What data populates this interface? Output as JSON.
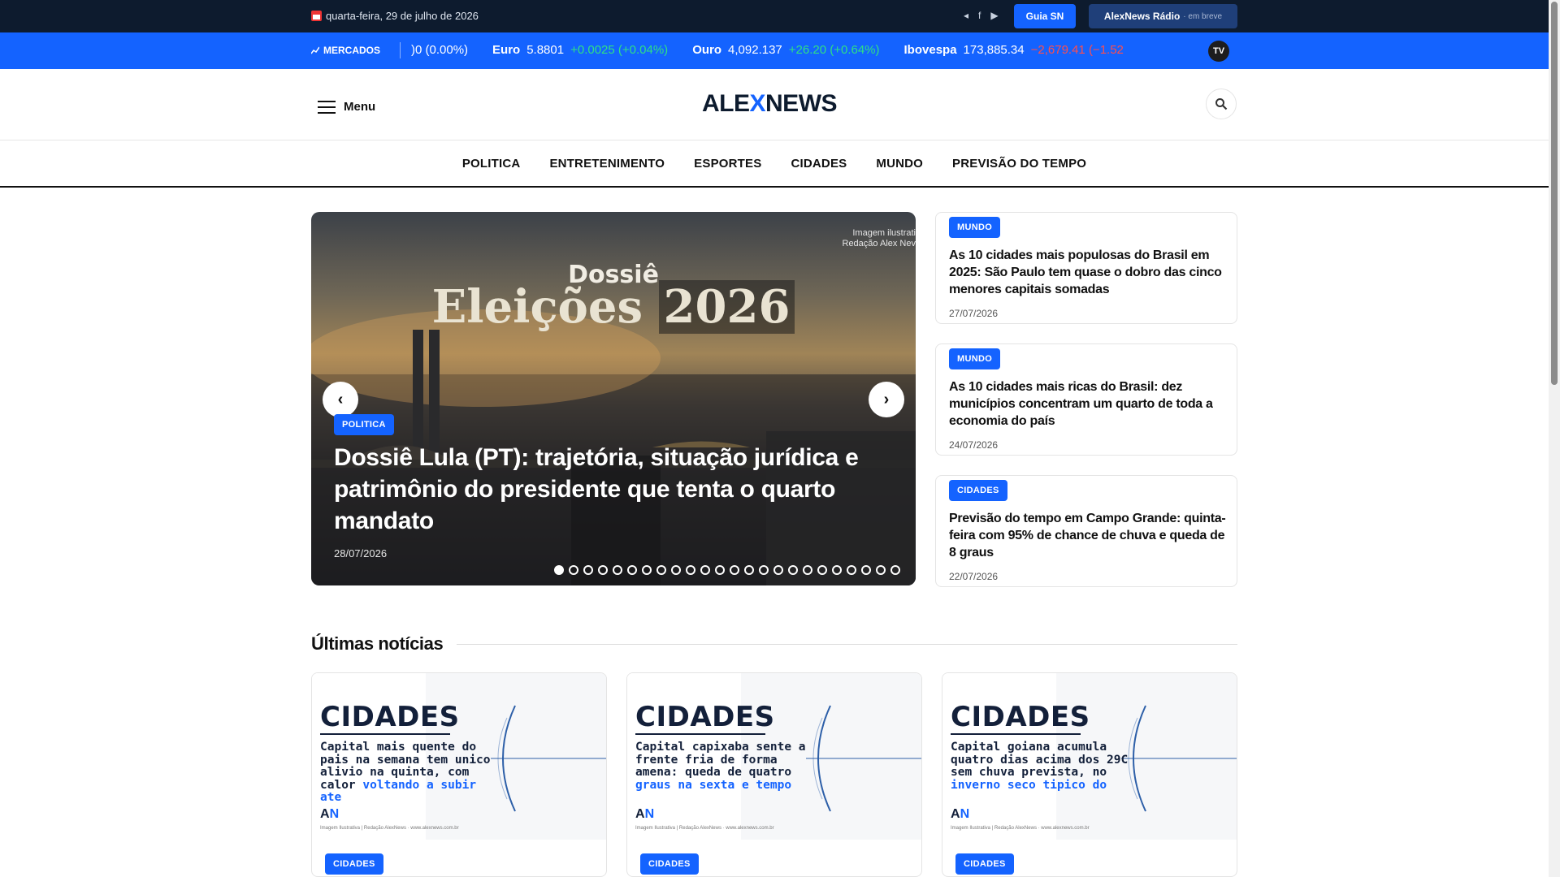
{
  "topbar": {
    "date": "quarta-feira, 29 de julho de 2026",
    "guia_label": "Guia SN",
    "radio_label": "AlexNews Rádio",
    "radio_soon": "· em breve"
  },
  "ticker": {
    "label": "MERCADOS",
    "items": [
      {
        "name": "",
        "value": ")0 (0.00%)",
        "change": "",
        "dir": "flat"
      },
      {
        "name": "Euro",
        "value": "5.8801",
        "change": "+0.0025 (+0.04%)",
        "dir": "up"
      },
      {
        "name": "Ouro",
        "value": "4,092.137",
        "change": "+26.20 (+0.64%)",
        "dir": "up"
      },
      {
        "name": "Ibovespa",
        "value": "173,885.34",
        "change": "−2,679.41 (−1.52",
        "dir": "down"
      }
    ],
    "tv_badge": "TV"
  },
  "header": {
    "menu_label": "Menu",
    "logo_part1": "ALE",
    "logo_x": "X",
    "logo_part2": "NEWS"
  },
  "nav": [
    "POLITICA",
    "ENTRETENIMENTO",
    "ESPORTES",
    "CIDADES",
    "MUNDO",
    "PREVISÃO DO TEMPO"
  ],
  "hero": {
    "watermark_line1": "Imagem ilustrati",
    "watermark_line2": "Redação Alex Nev",
    "image_title_top": "Dossiê",
    "image_title_main": "Eleições",
    "image_title_year": "2026",
    "category": "POLITICA",
    "title": "Dossiê Lula (PT): trajetória, situação jurídica e patrimônio do presidente que tenta o quarto mandato",
    "date": "28/07/2026",
    "slide_count": 24,
    "active_slide": 0
  },
  "side_cards": [
    {
      "category": "MUNDO",
      "title": "As 10 cidades mais populosas do Brasil em 2025: São Paulo tem quase o dobro das cinco menores capitais somadas",
      "date": "27/07/2026"
    },
    {
      "category": "MUNDO",
      "title": "As 10 cidades mais ricas do Brasil: dez municípios concentram um quarto de toda a economia do país",
      "date": "24/07/2026"
    },
    {
      "category": "CIDADES",
      "title": "Previsão do tempo em Campo Grande: quinta-feira com 95% de chance de chuva e queda de 8 graus",
      "date": "22/07/2026"
    }
  ],
  "latest": {
    "heading": "Últimas notícias",
    "cards": [
      {
        "thumb_heading": "CIDADES",
        "thumb_text": "Capital mais quente do pais na semana tem unico alivio na quinta, com calor",
        "thumb_text_blue": "voltando a subir ate",
        "logo_a": "A",
        "logo_n": "N",
        "footer": "Imagem Ilustrativa | Redação AlexNews · www.alexnews.com.br",
        "category": "CIDADES"
      },
      {
        "thumb_heading": "CIDADES",
        "thumb_text": "Capital capixaba sente a frente fria de forma amena: queda de quatro",
        "thumb_text_blue": "graus na sexta e tempo",
        "logo_a": "A",
        "logo_n": "N",
        "footer": "Imagem Ilustrativa | Redação AlexNews · www.alexnews.com.br",
        "category": "CIDADES"
      },
      {
        "thumb_heading": "CIDADES",
        "thumb_text": "Capital goiana acumula quatro dias acima dos 29C sem chuva prevista, no",
        "thumb_text_blue": "inverno seco tipico do",
        "logo_a": "A",
        "logo_n": "N",
        "footer": "Imagem Ilustrativa | Redação AlexNews · www.alexnews.com.br",
        "category": "CIDADES"
      }
    ]
  },
  "colors": {
    "accent": "#1463ff",
    "topbar": "#0d1b2e",
    "up": "#2fe084",
    "down": "#ff4d4d"
  }
}
